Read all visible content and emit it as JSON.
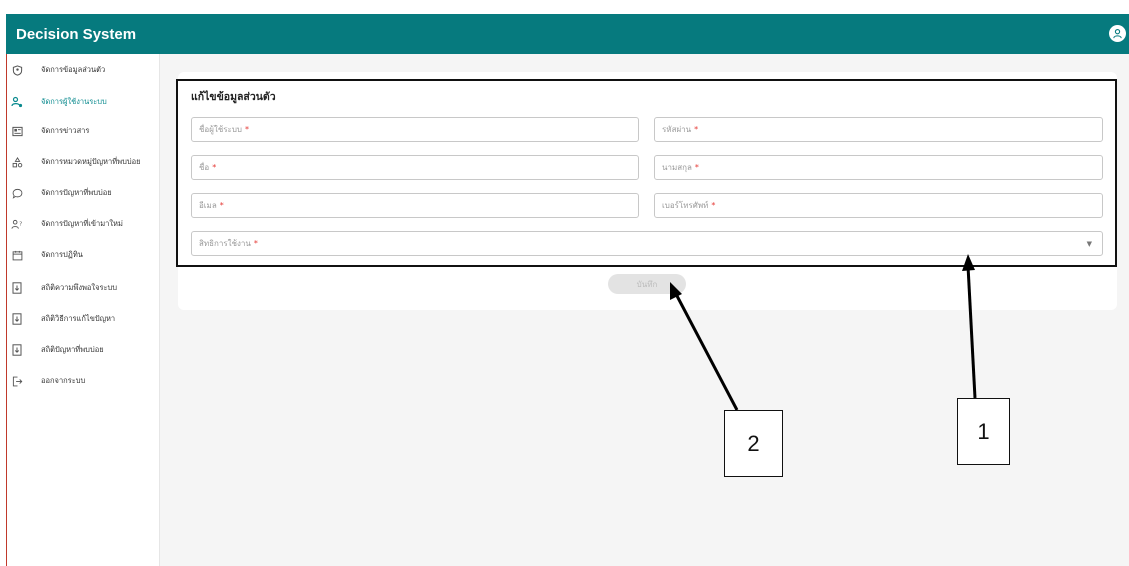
{
  "app": {
    "title": "Decision System"
  },
  "sidebar": {
    "items": [
      {
        "label": "จัดการข้อมูลส่วนตัว",
        "icon": "shield-user-icon",
        "active": false
      },
      {
        "label": "จัดการผู้ใช้งานระบบ",
        "icon": "users-cog-icon",
        "active": true
      },
      {
        "label": "จัดการข่าวสาร",
        "icon": "news-card-icon",
        "active": false
      },
      {
        "label": "จัดการหมวดหมู่ปัญหาที่พบบ่อย",
        "icon": "category-shapes-icon",
        "active": false
      },
      {
        "label": "จัดการปัญหาที่พบบ่อย",
        "icon": "chat-bubble-icon",
        "active": false
      },
      {
        "label": "จัดการปัญหาที่เข้ามาใหม่",
        "icon": "user-question-icon",
        "active": false
      },
      {
        "label": "จัดการปฏิทิน",
        "icon": "calendar-icon",
        "active": false
      },
      {
        "label": "สถิติความพึงพอใจระบบ",
        "icon": "report-download-icon",
        "active": false
      },
      {
        "label": "สถิติวิธีการแก้ไขปัญหา",
        "icon": "report-download-icon",
        "active": false
      },
      {
        "label": "สถิติปัญหาที่พบบ่อย",
        "icon": "report-download-icon",
        "active": false
      },
      {
        "label": "ออกจากระบบ",
        "icon": "logout-icon",
        "active": false
      }
    ]
  },
  "form": {
    "title": "แก้ไขข้อมูลส่วนตัว",
    "username_placeholder": "ชื่อผู้ใช้ระบบ",
    "password_placeholder": "รหัสผ่าน",
    "firstname_placeholder": "ชื่อ",
    "lastname_placeholder": "นามสกุล",
    "email_placeholder": "อีเมล",
    "phone_placeholder": "เบอร์โทรศัพท์",
    "role_placeholder": "สิทธิการใช้งาน",
    "required_mark": "*",
    "save_label": "บันทึก"
  },
  "callouts": {
    "one": "1",
    "two": "2"
  },
  "colors": {
    "header": "#067a7e",
    "accent": "#0a8a8e",
    "required": "#e53935"
  }
}
